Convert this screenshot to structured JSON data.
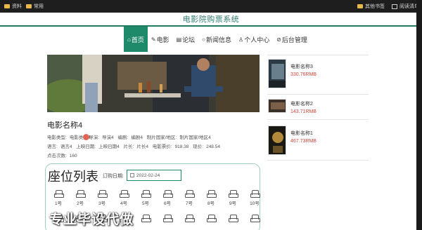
{
  "browser": {
    "bookmarks_left": [
      {
        "label": "资料",
        "icon": "folder-icon"
      },
      {
        "label": "常用",
        "icon": "folder-icon"
      }
    ],
    "bookmarks_right": [
      {
        "label": "其他书签",
        "icon": "folder-icon"
      },
      {
        "label": "阅读清单",
        "icon": "reading-list-icon"
      }
    ]
  },
  "site": {
    "title": "电影院购票系统"
  },
  "nav": {
    "items": [
      {
        "label": "首页",
        "icon": "home-icon",
        "active": true
      },
      {
        "label": "电影",
        "icon": "film-icon",
        "active": false
      },
      {
        "label": "论坛",
        "icon": "forum-icon",
        "active": false
      },
      {
        "label": "新闻信息",
        "icon": "news-icon",
        "active": false
      },
      {
        "label": "个人中心",
        "icon": "user-icon",
        "active": false
      },
      {
        "label": "后台管理",
        "icon": "admin-icon",
        "active": false
      }
    ]
  },
  "movie": {
    "name": "电影名称4",
    "type_label": "电影类型:",
    "type_value": "电影类型4",
    "director_label": "导演:",
    "director_value": "导演4",
    "writer_label": "编剧:",
    "writer_value": "编剧4",
    "country_label": "制片国家/地区:",
    "country_value": "制片国家/地区4",
    "language_label": "语言:",
    "language_value": "语言4",
    "release_label": "上映日期:",
    "release_value": "上映日期4",
    "length_label": "片长:",
    "length_value": "片长4",
    "boxoffice_label": "电影票价:",
    "boxoffice_value": "918.38",
    "price_label": "现价:",
    "price_value": "248.54",
    "clicks_label": "点击次数:",
    "clicks_value": "160"
  },
  "seats": {
    "heading": "座位列表",
    "date_label": "订购日期:",
    "date_value": "2022-02-24",
    "row1": [
      "1号",
      "2号",
      "3号",
      "4号",
      "5号",
      "6号",
      "7号",
      "8号",
      "9号",
      "10号"
    ]
  },
  "watermark": "专业毕设代做",
  "sidebar": {
    "items": [
      {
        "name": "电影名称3",
        "price": "330.76RMB"
      },
      {
        "name": "电影名称2",
        "price": "143.71RMB"
      },
      {
        "name": "电影名称1",
        "price": "467.73RMB"
      }
    ]
  }
}
